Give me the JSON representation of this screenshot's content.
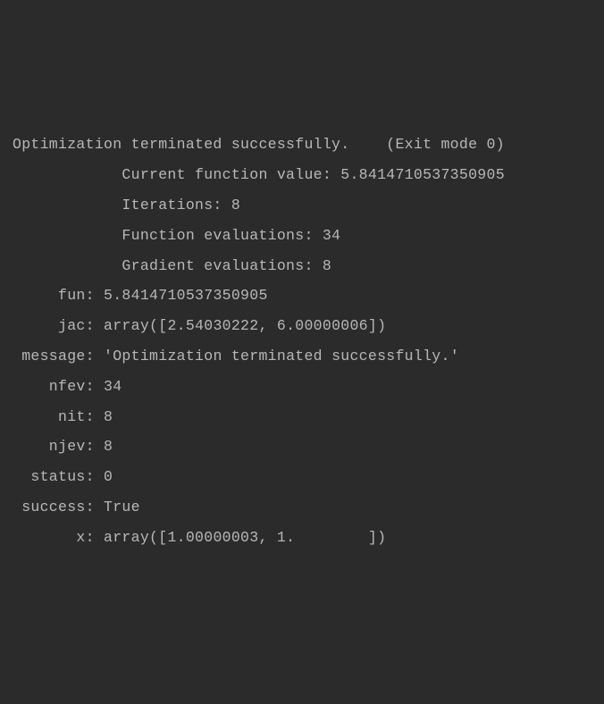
{
  "output": {
    "header_line": "Optimization terminated successfully.    (Exit mode 0)",
    "summary": {
      "current_function_value_label": "            Current function value: ",
      "current_function_value": "5.8414710537350905",
      "iterations_label": "            Iterations: ",
      "iterations": "8",
      "function_evaluations_label": "            Function evaluations: ",
      "function_evaluations": "34",
      "gradient_evaluations_label": "            Gradient evaluations: ",
      "gradient_evaluations": "8"
    },
    "result": {
      "fun_label": "     fun: ",
      "fun": "5.8414710537350905",
      "jac_label": "     jac: ",
      "jac": "array([2.54030222, 6.00000006])",
      "message_label": " message: ",
      "message": "'Optimization terminated successfully.'",
      "nfev_label": "    nfev: ",
      "nfev": "34",
      "nit_label": "     nit: ",
      "nit": "8",
      "njev_label": "    njev: ",
      "njev": "8",
      "status_label": "  status: ",
      "status": "0",
      "success_label": " success: ",
      "success": "True",
      "x_label": "       x: ",
      "x": "array([1.00000003, 1.        ])"
    }
  }
}
